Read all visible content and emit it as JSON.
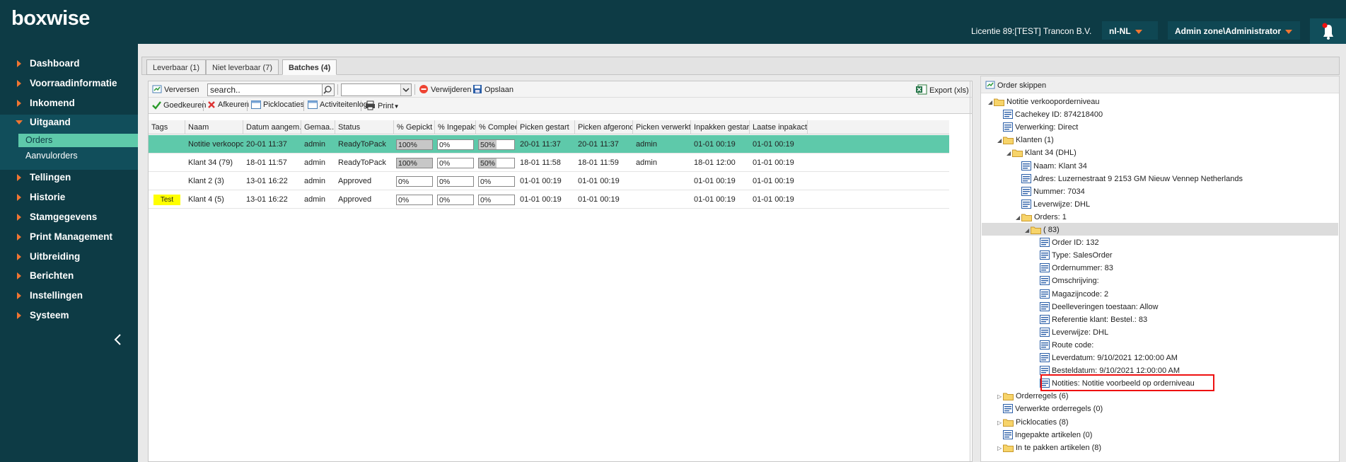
{
  "header": {
    "logo": "boxwise",
    "license": "Licentie 89:[TEST] Trancon B.V.",
    "language": "nl-NL",
    "user": "Admin zone\\Administrator"
  },
  "sidebar": {
    "items": [
      "Dashboard",
      "Voorraadinformatie",
      "Inkomend",
      "Uitgaand",
      "Tellingen",
      "Historie",
      "Stamgegevens",
      "Print Management",
      "Uitbreiding",
      "Berichten",
      "Instellingen",
      "Systeem"
    ],
    "sub": [
      "Orders",
      "Aanvulorders"
    ]
  },
  "tabs": [
    "Leverbaar (1)",
    "Niet leverbaar (7)",
    "Batches (4)"
  ],
  "toolbar": {
    "refresh": "Verversen",
    "search_value": "search..",
    "delete": "Verwijderen",
    "save": "Opslaan",
    "export": "Export (xls)",
    "approve": "Goedkeuren",
    "reject": "Afkeuren",
    "picklocations": "Picklocaties",
    "activitylog": "Activiteitenlog",
    "print": "Print"
  },
  "grid": {
    "columns": [
      "Tags",
      "Naam",
      "Datum aangem...",
      "Gemaa...",
      "Status",
      "% Gepickt",
      "% Ingepakt",
      "% Compleet",
      "Picken gestart",
      "Picken afgerond",
      "Picken verwerkt ...",
      "Inpakken gestart",
      "Laatse inpakacti..."
    ],
    "rows": [
      {
        "tag": "",
        "naam": "Notitie verkoopo...",
        "datum": "20-01 11:37",
        "gemaakt": "admin",
        "status": "ReadyToPack",
        "gepickt": "100%",
        "gepickt_v": 1.0,
        "ingepakt": "0%",
        "ingepakt_v": 0,
        "compleet": "50%",
        "compleet_v": 0.5,
        "ps": "20-01 11:37",
        "pa": "20-01 11:37",
        "pv": "admin",
        "ig": "01-01 00:19",
        "li": "01-01 00:19"
      },
      {
        "tag": "",
        "naam": "Klant 34 (79)",
        "datum": "18-01 11:57",
        "gemaakt": "admin",
        "status": "ReadyToPack",
        "gepickt": "100%",
        "gepickt_v": 1.0,
        "ingepakt": "0%",
        "ingepakt_v": 0,
        "compleet": "50%",
        "compleet_v": 0.5,
        "ps": "18-01 11:58",
        "pa": "18-01 11:59",
        "pv": "admin",
        "ig": "18-01 12:00",
        "li": "01-01 00:19"
      },
      {
        "tag": "",
        "naam": "Klant 2 (3)",
        "datum": "13-01 16:22",
        "gemaakt": "admin",
        "status": "Approved",
        "gepickt": "0%",
        "gepickt_v": 0,
        "ingepakt": "0%",
        "ingepakt_v": 0,
        "compleet": "0%",
        "compleet_v": 0,
        "ps": "01-01 00:19",
        "pa": "01-01 00:19",
        "pv": "",
        "ig": "01-01 00:19",
        "li": "01-01 00:19"
      },
      {
        "tag": "Test",
        "naam": "Klant 4 (5)",
        "datum": "13-01 16:22",
        "gemaakt": "admin",
        "status": "Approved",
        "gepickt": "0%",
        "gepickt_v": 0,
        "ingepakt": "0%",
        "ingepakt_v": 0,
        "compleet": "0%",
        "compleet_v": 0,
        "ps": "01-01 00:19",
        "pa": "01-01 00:19",
        "pv": "",
        "ig": "01-01 00:19",
        "li": "01-01 00:19"
      }
    ]
  },
  "tree": {
    "skip": "Order skippen",
    "nodes": [
      {
        "d": 0,
        "t": "Notitie verkooporderniveau",
        "k": "folder",
        "e": "o"
      },
      {
        "d": 1,
        "t": "Cachekey ID: 874218400",
        "k": "leaf"
      },
      {
        "d": 1,
        "t": "Verwerking: Direct",
        "k": "leaf"
      },
      {
        "d": 1,
        "t": "Klanten (1)",
        "k": "folder",
        "e": "o"
      },
      {
        "d": 2,
        "t": "Klant 34 (DHL)",
        "k": "folder",
        "e": "o"
      },
      {
        "d": 3,
        "t": "Naam: Klant 34",
        "k": "leaf"
      },
      {
        "d": 3,
        "t": "Adres: Luzernestraat 9 2153 GM Nieuw Vennep Netherlands",
        "k": "leaf"
      },
      {
        "d": 3,
        "t": "Nummer: 7034",
        "k": "leaf"
      },
      {
        "d": 3,
        "t": "Leverwijze: DHL",
        "k": "leaf"
      },
      {
        "d": 3,
        "t": "Orders: 1",
        "k": "folder",
        "e": "o"
      },
      {
        "d": 4,
        "t": "( 83)",
        "k": "folder",
        "e": "o"
      },
      {
        "d": 5,
        "t": "Order ID: 132",
        "k": "leaf"
      },
      {
        "d": 5,
        "t": "Type: SalesOrder",
        "k": "leaf"
      },
      {
        "d": 5,
        "t": "Ordernummer: 83",
        "k": "leaf"
      },
      {
        "d": 5,
        "t": "Omschrijving:",
        "k": "leaf"
      },
      {
        "d": 5,
        "t": "Magazijncode: 2",
        "k": "leaf"
      },
      {
        "d": 5,
        "t": "Deelleveringen toestaan: Allow",
        "k": "leaf"
      },
      {
        "d": 5,
        "t": "Referentie klant: Bestel.: 83",
        "k": "leaf"
      },
      {
        "d": 5,
        "t": "Leverwijze: DHL",
        "k": "leaf"
      },
      {
        "d": 5,
        "t": "Route code:",
        "k": "leaf"
      },
      {
        "d": 5,
        "t": "Leverdatum: 9/10/2021 12:00:00 AM",
        "k": "leaf"
      },
      {
        "d": 5,
        "t": "Besteldatum: 9/10/2021 12:00:00 AM",
        "k": "leaf"
      },
      {
        "d": 5,
        "t": "Notities: Notitie voorbeeld op orderniveau",
        "k": "leaf"
      },
      {
        "d": 1,
        "t": "Orderregels (6)",
        "k": "folder",
        "e": "c"
      },
      {
        "d": 1,
        "t": "Verwerkte orderregels (0)",
        "k": "leaf"
      },
      {
        "d": 1,
        "t": "Picklocaties (8)",
        "k": "folder",
        "e": "c"
      },
      {
        "d": 1,
        "t": "Ingepakte artikelen (0)",
        "k": "leaf"
      },
      {
        "d": 1,
        "t": "In te pakken artikelen (8)",
        "k": "folder",
        "e": "c"
      }
    ]
  },
  "colors": {
    "brand": "#0d3b45",
    "accent": "#f07532",
    "selected": "#5ec9aa",
    "highlight": "#ee1111"
  }
}
